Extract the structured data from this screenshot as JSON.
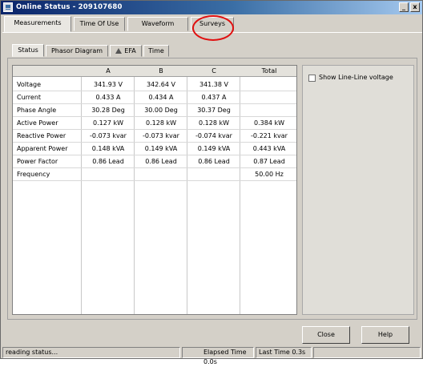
{
  "window": {
    "title": "Online Status - 209107680",
    "minimize_glyph": "_",
    "close_glyph": "x"
  },
  "tabs": [
    {
      "label": "Measurements",
      "active": true
    },
    {
      "label": "Time Of Use",
      "active": false
    },
    {
      "label": "Waveform",
      "active": false
    },
    {
      "label": "Surveys",
      "active": false
    }
  ],
  "subtabs": [
    {
      "label": "Status",
      "active": true
    },
    {
      "label": "Phasor Diagram",
      "active": false
    },
    {
      "label": "EFA",
      "active": false,
      "icon": "warning-icon"
    },
    {
      "label": "Time",
      "active": false
    }
  ],
  "table": {
    "headers": [
      "",
      "A",
      "B",
      "C",
      "Total"
    ],
    "rows": [
      [
        "Voltage",
        "341.93 V",
        "342.64 V",
        "341.38 V",
        ""
      ],
      [
        "Current",
        "0.433 A",
        "0.434 A",
        "0.437 A",
        ""
      ],
      [
        "Phase Angle",
        "30.28 Deg",
        "30.00 Deg",
        "30.37 Deg",
        ""
      ],
      [
        "Active Power",
        "0.127 kW",
        "0.128 kW",
        "0.128 kW",
        "0.384 kW"
      ],
      [
        "Reactive Power",
        "-0.073 kvar",
        "-0.073 kvar",
        "-0.074 kvar",
        "-0.221 kvar"
      ],
      [
        "Apparent Power",
        "0.148 kVA",
        "0.149 kVA",
        "0.149 kVA",
        "0.443 kVA"
      ],
      [
        "Power Factor",
        "0.86 Lead",
        "0.86 Lead",
        "0.86 Lead",
        "0.87 Lead"
      ],
      [
        "Frequency",
        "",
        "",
        "",
        "50.00 Hz"
      ]
    ]
  },
  "options": {
    "show_line_line_label": "Show Line-Line voltage",
    "show_line_line_checked": false
  },
  "buttons": {
    "close": "Close",
    "help": "Help"
  },
  "status": {
    "message": "reading status...",
    "elapsed": "Elapsed Time 0.0s",
    "last": "Last Time 0.3s"
  },
  "colors": {
    "annotation": "#e01010",
    "title_bar": "#0a246a"
  }
}
